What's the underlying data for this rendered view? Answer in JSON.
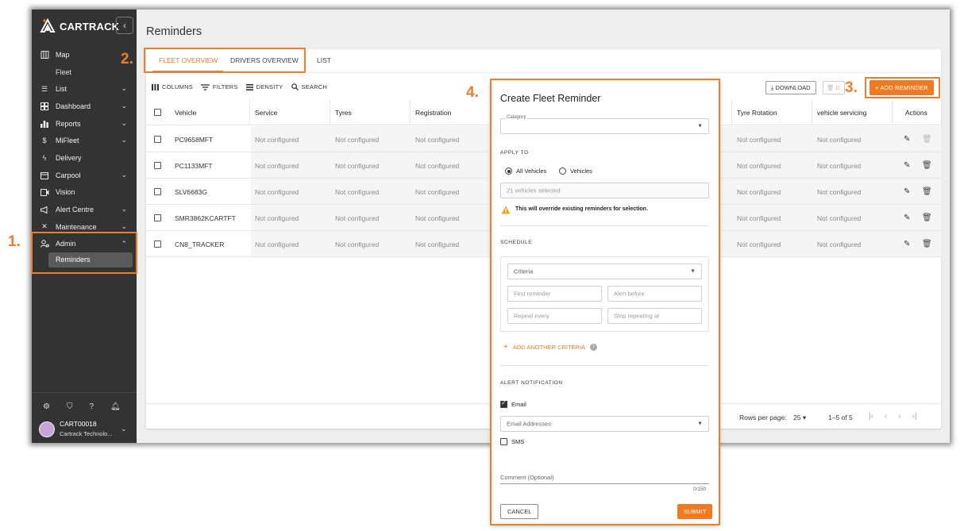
{
  "brand": {
    "name": "CARTRACK",
    "accent": "#f07a22",
    "sidebar_bg": "#333333"
  },
  "sidebar": {
    "collapse_icon": "chevron-left-icon",
    "items": [
      {
        "label": "Map",
        "icon": "map-icon",
        "expandable": false
      },
      {
        "label": "Fleet",
        "icon": "",
        "expandable": false,
        "sub": true
      },
      {
        "label": "List",
        "icon": "list-icon",
        "expandable": true
      },
      {
        "label": "Dashboard",
        "icon": "dashboard-icon",
        "expandable": true
      },
      {
        "label": "Reports",
        "icon": "bar-chart-icon",
        "expandable": true
      },
      {
        "label": "MiFleet",
        "icon": "dollar-icon",
        "expandable": true
      },
      {
        "label": "Delivery",
        "icon": "lightning-icon",
        "expandable": false
      },
      {
        "label": "Carpool",
        "icon": "calendar-icon",
        "expandable": true
      },
      {
        "label": "Vision",
        "icon": "video-icon",
        "expandable": false
      },
      {
        "label": "Alert Centre",
        "icon": "megaphone-icon",
        "expandable": true
      },
      {
        "label": "Maintenance",
        "icon": "tools-icon",
        "expandable": true
      },
      {
        "label": "Admin",
        "icon": "admin-icon",
        "expandable": true,
        "expanded": true
      }
    ],
    "active_sub": "Reminders",
    "bottom_icons": [
      "settings-icon",
      "shield-icon",
      "help-icon",
      "bell-icon"
    ],
    "account": {
      "id": "CART00018",
      "company": "Cartrack Technolo..."
    }
  },
  "page": {
    "title": "Reminders"
  },
  "tabs": [
    "FLEET OVERVIEW",
    "DRIVERS OVERVIEW",
    "LIST"
  ],
  "toolbar": {
    "columns": "COLUMNS",
    "filters": "FILTERS",
    "density": "DENSITY",
    "search": "SEARCH",
    "download": "DOWNLOAD",
    "delete": "D",
    "add_reminder": "ADD REMINDER"
  },
  "table": {
    "headers": [
      "Vehicle",
      "Service",
      "Tyres",
      "Registration",
      "Tyre Rotation",
      "vehicle servicing",
      "Actions"
    ],
    "rows": [
      {
        "vehicle": "PC9658MFT",
        "service": "Not configured",
        "tyres": "Not configured",
        "registration": "Not configured",
        "tyre_rotation": "Not configured",
        "vehicle_servicing": "Not configured",
        "delete_enabled": false
      },
      {
        "vehicle": "PC1133MFT",
        "service": "Not configured",
        "tyres": "Not configured",
        "registration": "Not configured",
        "tyre_rotation": "Not configured",
        "vehicle_servicing": "Not configured",
        "delete_enabled": true
      },
      {
        "vehicle": "SLV6683G",
        "service": "Not configured",
        "tyres": "Not configured",
        "registration": "Not configured",
        "tyre_rotation": "Not configured",
        "vehicle_servicing": "Not configured",
        "delete_enabled": true
      },
      {
        "vehicle": "SMR3862KCARTFT",
        "service": "Not configured",
        "tyres": "Not configured",
        "registration": "Not configured",
        "tyre_rotation": "Not configured",
        "vehicle_servicing": "Not configured",
        "delete_enabled": true
      },
      {
        "vehicle": "CN8_TRACKER",
        "service": "Not configured",
        "tyres": "Not configured",
        "registration": "Not configured",
        "tyre_rotation": "Not configured",
        "vehicle_servicing": "Not configured",
        "delete_enabled": true
      }
    ]
  },
  "pagination": {
    "rows_per_page_label": "Rows per page:",
    "rows_per_page": "25",
    "range": "1–5 of 5"
  },
  "modal": {
    "title": "Create Fleet Reminder",
    "category_label": "Category",
    "apply_to": "APPLY TO",
    "all_vehicles": "All Vehicles",
    "vehicles": "Vehicles",
    "vehicles_placeholder": "21 vehicles selected",
    "warning": "This will override existing reminders for selection.",
    "schedule": "SCHEDULE",
    "criteria": "Criteria",
    "first_reminder": "First reminder",
    "alert_before": "Alert before",
    "repeat_every": "Repeat every",
    "stop_repeating": "Stop repeating at",
    "add_criteria": "ADD ANOTHER CRITERIA",
    "alert_notification": "ALERT NOTIFICATION",
    "email": "Email",
    "email_addresses": "Email Addresses",
    "sms": "SMS",
    "comment": "Comment (Optional)",
    "counter": "0/150",
    "cancel": "CANCEL",
    "submit": "SUBMIT"
  },
  "annotations": [
    "1.",
    "2.",
    "3.",
    "4."
  ]
}
